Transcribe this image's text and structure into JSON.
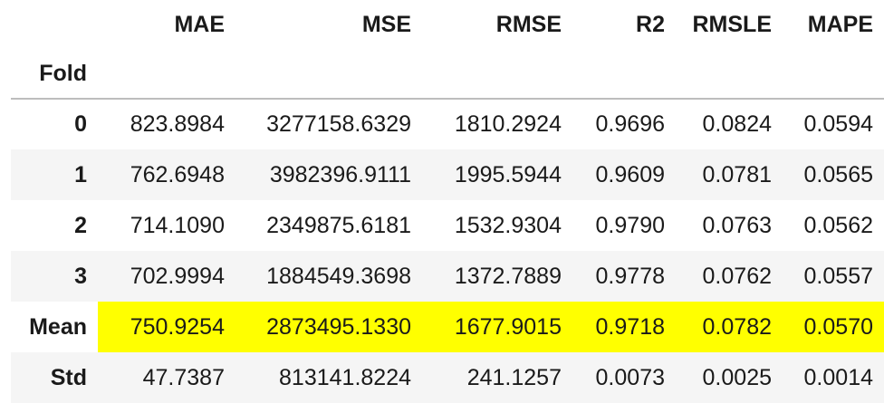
{
  "table": {
    "columns": [
      "MAE",
      "MSE",
      "RMSE",
      "R2",
      "RMSLE",
      "MAPE"
    ],
    "index_name": "Fold",
    "rows": [
      {
        "label": "0",
        "values": [
          "823.8984",
          "3277158.6329",
          "1810.2924",
          "0.9696",
          "0.0824",
          "0.0594"
        ]
      },
      {
        "label": "1",
        "values": [
          "762.6948",
          "3982396.9111",
          "1995.5944",
          "0.9609",
          "0.0781",
          "0.0565"
        ]
      },
      {
        "label": "2",
        "values": [
          "714.1090",
          "2349875.6181",
          "1532.9304",
          "0.9790",
          "0.0763",
          "0.0562"
        ]
      },
      {
        "label": "3",
        "values": [
          "702.9994",
          "1884549.3698",
          "1372.7889",
          "0.9778",
          "0.0762",
          "0.0557"
        ]
      },
      {
        "label": "Mean",
        "values": [
          "750.9254",
          "2873495.1330",
          "1677.9015",
          "0.9718",
          "0.0782",
          "0.0570"
        ]
      },
      {
        "label": "Std",
        "values": [
          "47.7387",
          "813141.8224",
          "241.1257",
          "0.0073",
          "0.0025",
          "0.0014"
        ]
      }
    ],
    "highlight_row": "Mean",
    "highlight_color": "#ffff00",
    "stripe_color": "#f5f5f5",
    "header_rule_color": "#bdbdbd"
  }
}
